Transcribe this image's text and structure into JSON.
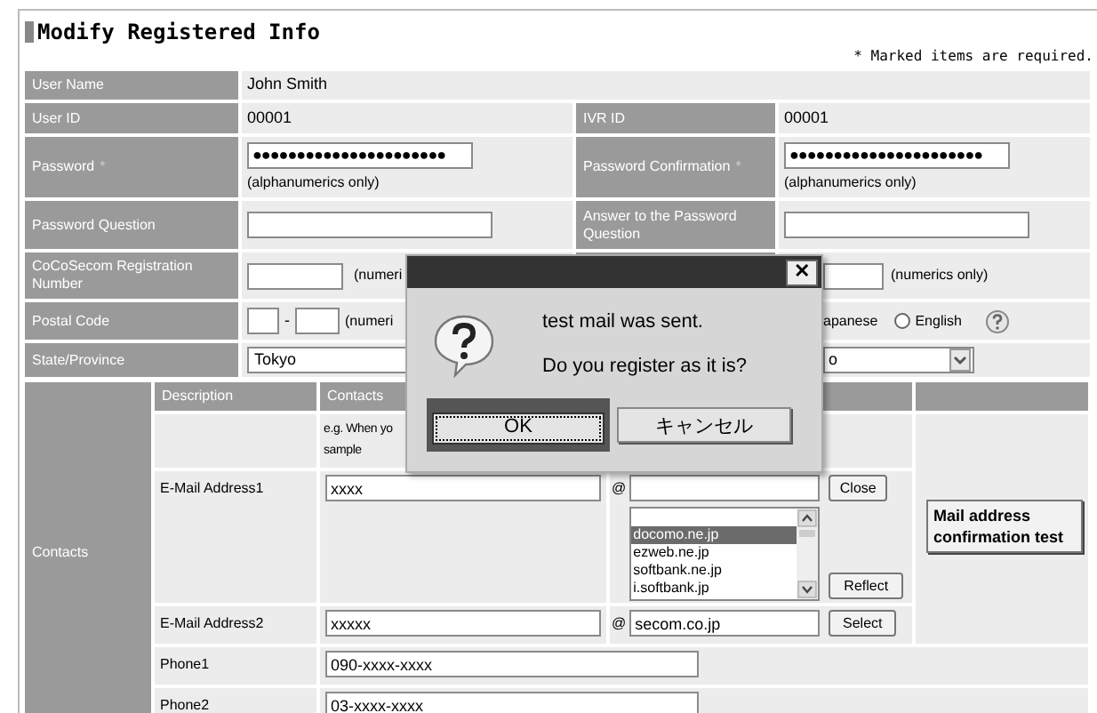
{
  "page": {
    "title": "Modify Registered Info",
    "required_note": "* Marked items are required."
  },
  "user_name": {
    "label": "User Name",
    "value": "John Smith"
  },
  "user_id": {
    "label": "User ID",
    "value": "00001"
  },
  "ivr_id": {
    "label": "IVR ID",
    "value": "00001"
  },
  "password": {
    "label": "Password",
    "required_mark": "*",
    "value": "●●●●●●●●●●●●●●●●●●●●●●",
    "note": "(alphanumerics only)"
  },
  "password_confirmation": {
    "label": "Password Confirmation",
    "required_mark": "*",
    "value": "●●●●●●●●●●●●●●●●●●●●●●",
    "note": "(alphanumerics only)"
  },
  "password_question": {
    "label": "Password Question"
  },
  "password_answer": {
    "label": "Answer to the Password Question"
  },
  "registration_number": {
    "label": "CoCoSecom Registration Number",
    "note": "(numeri"
  },
  "registration_number_right": {
    "note": "(numerics only)"
  },
  "postal_code": {
    "label": "Postal Code",
    "separator": "-",
    "note": "(numeri"
  },
  "language": {
    "partial_label": "apanese",
    "options": [
      {
        "label": "English",
        "selected": false
      }
    ]
  },
  "state": {
    "label": "State/Province",
    "value": "Tokyo"
  },
  "state_right": {
    "value": "o"
  },
  "contacts": {
    "label": "Contacts",
    "columns": [
      "Description",
      "Contacts"
    ],
    "example_lines": [
      "e.g. When yo",
      "sample"
    ]
  },
  "email1": {
    "label": "E-Mail Address1",
    "local": "xxxx",
    "at": "@",
    "close_button": "Close",
    "reflect_button": "Reflect",
    "domain_options": [
      {
        "label": "docomo.ne.jp",
        "selected": true
      },
      {
        "label": "ezweb.ne.jp",
        "selected": false
      },
      {
        "label": "softbank.ne.jp",
        "selected": false
      },
      {
        "label": "i.softbank.jp",
        "selected": false
      }
    ]
  },
  "email2": {
    "label": "E-Mail Address2",
    "local": "xxxxx",
    "at": "@",
    "domain": "secom.co.jp",
    "select_button": "Select"
  },
  "confirm_button": "Mail address confirmation test",
  "phones": [
    {
      "label": "Phone1",
      "value": "090-xxxx-xxxx"
    },
    {
      "label": "Phone2",
      "value": "03-xxxx-xxxx"
    }
  ],
  "dialog": {
    "close": "✕",
    "message_lines": [
      "test mail was sent.",
      "Do you register as it is?"
    ],
    "buttons": [
      {
        "label": "OK",
        "selected": true
      },
      {
        "label": "キャンセル",
        "selected": false
      }
    ]
  }
}
